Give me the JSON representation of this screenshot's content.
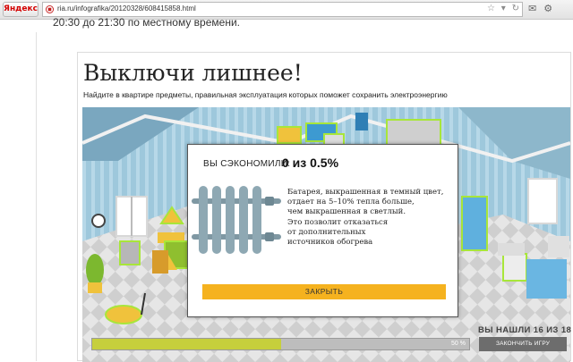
{
  "browser": {
    "brand": "Яндекс",
    "url": "ria.ru/infografika/20120328/608415858.html"
  },
  "page": {
    "top_text": "20:30 до 21:30 по местному времени."
  },
  "infographic": {
    "title": "Выключи лишнее!",
    "subtitle": "Найдите в квартире предметы, правильная эксплуатация которых поможет сохранить электроэнергию"
  },
  "modal": {
    "saved_label": "ВЫ СЭКОНОМИЛИ:",
    "saved_value": "0 из 0.5%",
    "fact_lines": [
      "Батарея, выкрашенная в темный цвет,",
      "отдает на 5–10% тепла больше,",
      "чем выкрашенная в светлый.",
      "Это позволит отказаться",
      "от дополнительных",
      "источников обогрева"
    ],
    "close_label": "ЗАКРЫТЬ"
  },
  "game": {
    "found_label": "ВЫ НАШЛИ 16 ИЗ 18",
    "progress_percent": 50,
    "progress_label": "50 %",
    "end_label": "ЗАКОНЧИТЬ ИГРУ"
  },
  "colors": {
    "accent": "#f5b21f",
    "progress": "#c6cf3c",
    "highlight": "#a8e63a"
  }
}
